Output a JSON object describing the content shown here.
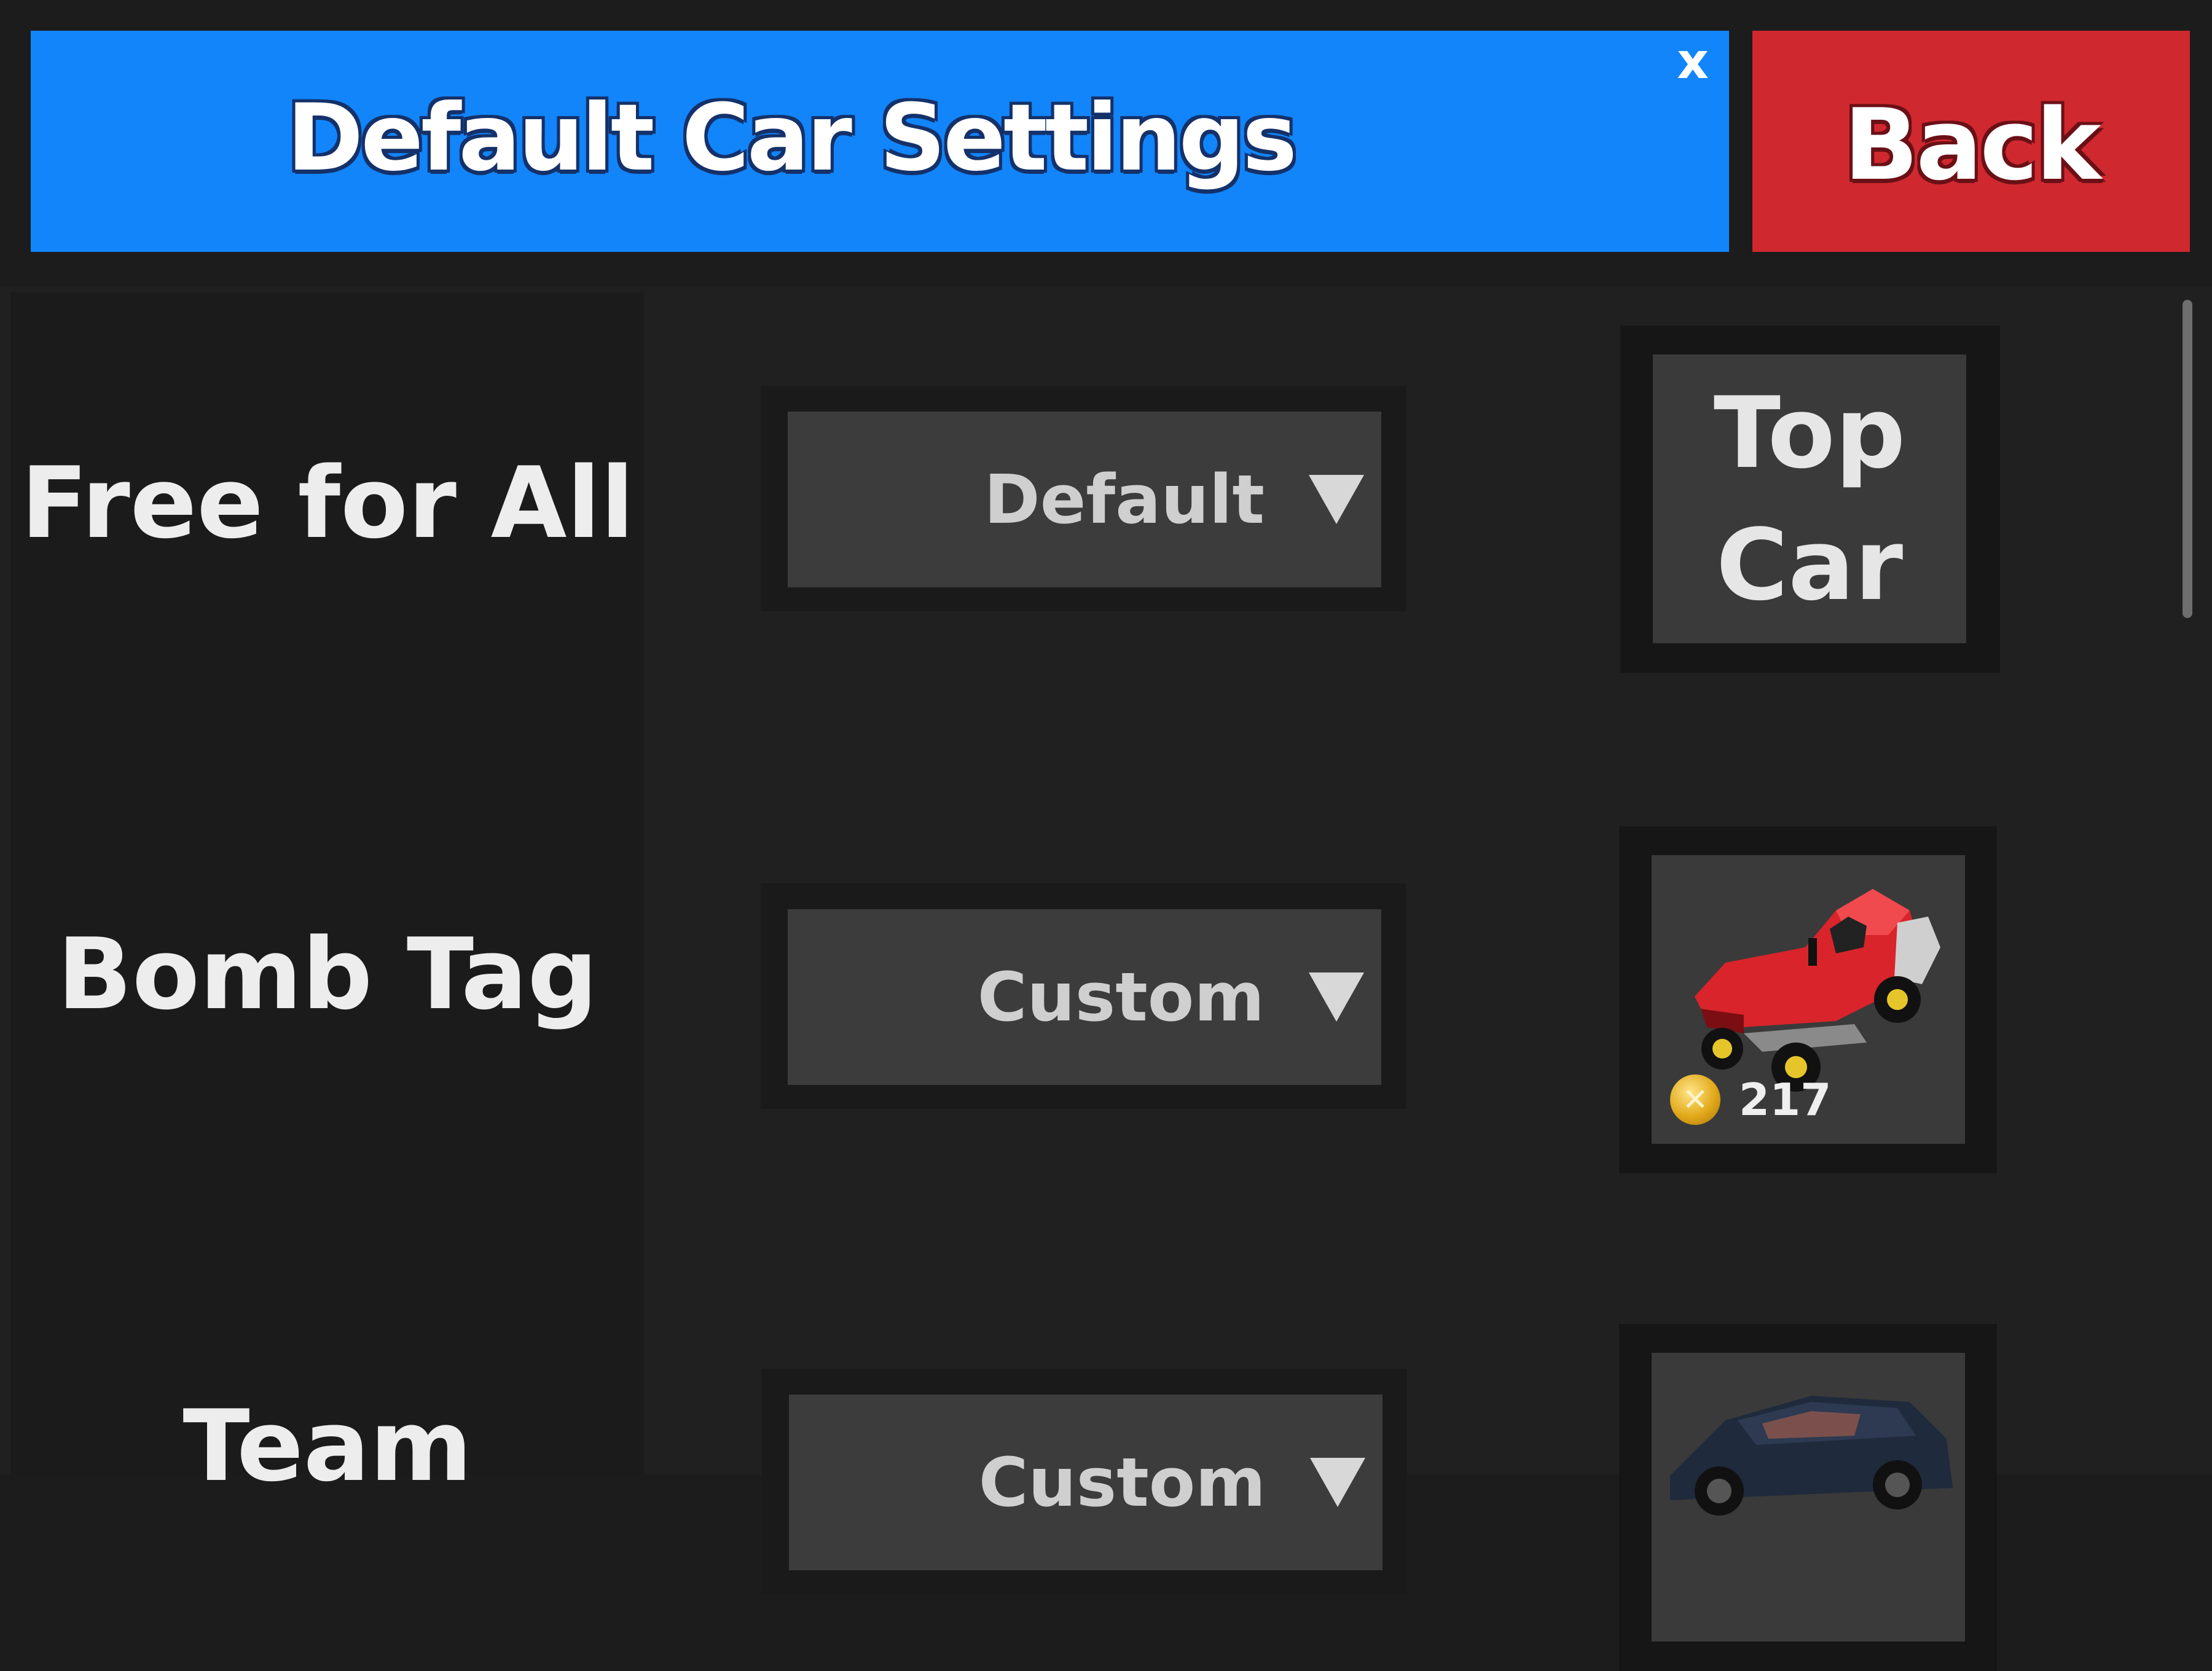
{
  "header": {
    "title": "Default Car Settings",
    "close_label": "x",
    "back_label": "Back"
  },
  "modes": [
    {
      "label": "Free for All",
      "selection": "Default",
      "card": {
        "type": "text",
        "lines": [
          "Top",
          "Car"
        ]
      }
    },
    {
      "label": "Bomb Tag",
      "selection": "Custom",
      "card": {
        "type": "car",
        "car_icon": "red-lawnmower-icon",
        "coin_amount": "217"
      }
    },
    {
      "label": "Team",
      "selection": "Custom",
      "card": {
        "type": "car",
        "car_icon": "dark-blue-suv-icon"
      }
    }
  ],
  "colors": {
    "title_bar": "#1285fb",
    "back_button": "#d0282f",
    "background": "#202020"
  }
}
